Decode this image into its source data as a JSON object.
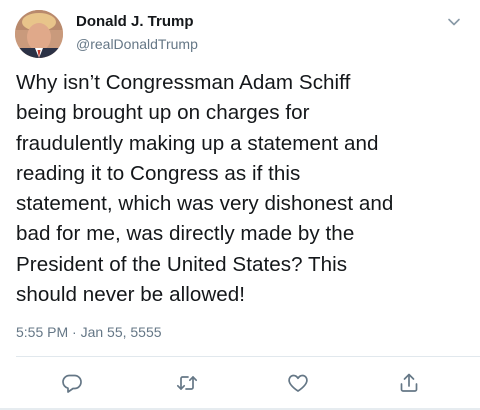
{
  "author": {
    "display_name": "Donald J. Trump",
    "handle": "@realDonaldTrump"
  },
  "tweet": {
    "text": "Why isn’t Congressman Adam Schiff\nbeing brought up on charges for\nfraudulently making up a statement and\nreading it to Congress as if this\nstatement, which was very dishonest and\nbad for me, was directly made by the\nPresident of the United States? This\nshould never be allowed!",
    "timestamp": "5:55 PM · Jan 55, 5555"
  },
  "actions": {
    "icons": [
      "reply-icon",
      "retweet-icon",
      "like-icon",
      "share-icon"
    ]
  },
  "colors": {
    "text_primary": "#14171a",
    "text_secondary": "#657786",
    "icon": "#657786",
    "divider": "#e1e8ed"
  }
}
